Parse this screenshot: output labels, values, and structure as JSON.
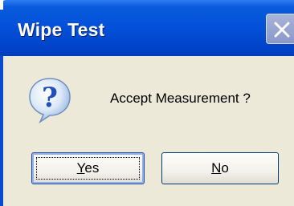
{
  "window": {
    "title": "Wipe Test"
  },
  "message": {
    "text": "Accept Measurement ?",
    "icon": "question-icon"
  },
  "buttons": {
    "yes": {
      "mnemonic": "Y",
      "rest": "es"
    },
    "no": {
      "mnemonic": "N",
      "rest": "o"
    }
  },
  "colors": {
    "titlebar": "#0350d8",
    "body": "#ece9d8",
    "question_icon": "#2a5fc4"
  }
}
